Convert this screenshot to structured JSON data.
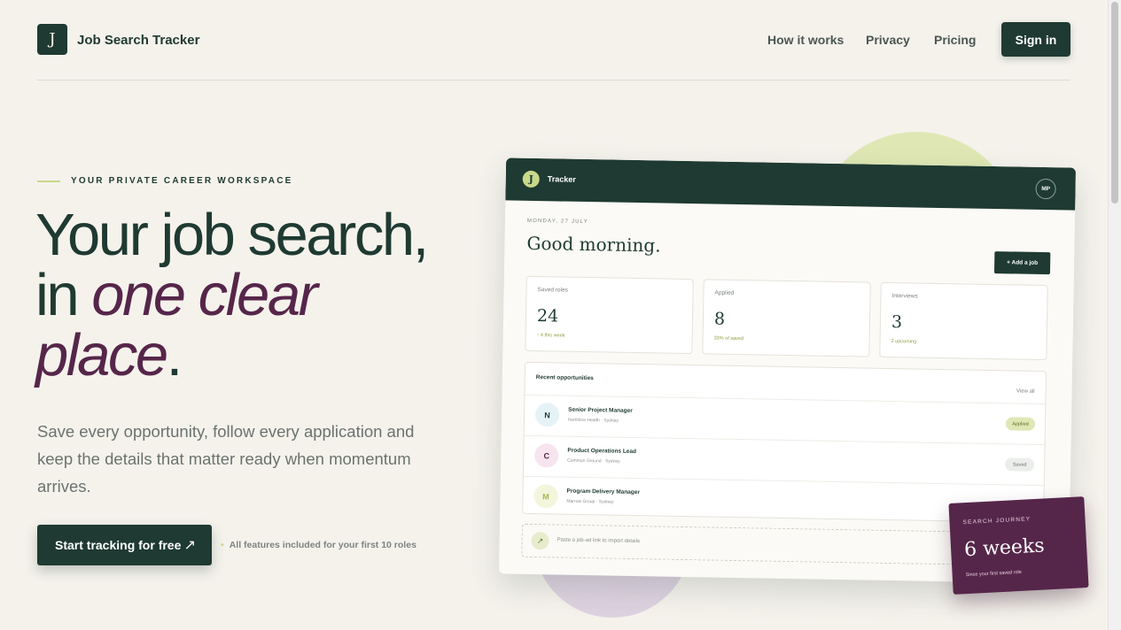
{
  "header": {
    "logo_letter": "J",
    "brand": "Job Search Tracker",
    "nav": [
      "How it works",
      "Privacy",
      "Pricing"
    ],
    "signin_label": "Sign in"
  },
  "hero": {
    "eyebrow": "YOUR PRIVATE CAREER WORKSPACE",
    "headline_line1": "Your job search,",
    "headline_in": "in ",
    "headline_italic1": "one clear",
    "headline_italic2": "place",
    "headline_period": ".",
    "lede": "Save every opportunity, follow every application and keep the details that matter ready when momentum arrives.",
    "cta_label": "Start tracking for free",
    "cta_arrow": "↗",
    "cta_note": "All features included for your first 10 roles"
  },
  "app": {
    "logo_letter": "J",
    "title": "Tracker",
    "avatar": "MP",
    "date": "MONDAY, 27 JULY",
    "greeting": "Good morning.",
    "add_job": "+ Add a job",
    "stats": [
      {
        "label": "Saved roles",
        "value": "24",
        "sub": "↑ 4 this week"
      },
      {
        "label": "Applied",
        "value": "8",
        "sub": "33% of saved"
      },
      {
        "label": "Interviews",
        "value": "3",
        "sub": "2 upcoming"
      }
    ],
    "opportunities": {
      "title": "Recent opportunities",
      "view_all": "View all",
      "rows": [
        {
          "initial": "N",
          "role": "Senior Project Manager",
          "meta": "Northline Health · Sydney",
          "status": "Applied"
        },
        {
          "initial": "C",
          "role": "Product Operations Lead",
          "meta": "Common Ground · Sydney",
          "status": "Saved"
        },
        {
          "initial": "M",
          "role": "Program Delivery Manager",
          "meta": "Marrow Group · Sydney",
          "status": ""
        }
      ]
    },
    "paste_icon": "↗",
    "paste_text": "Paste a job-ad link to import details"
  },
  "journey": {
    "label": "SEARCH JOURNEY",
    "value": "6 weeks",
    "sub": "Since your first saved role"
  }
}
